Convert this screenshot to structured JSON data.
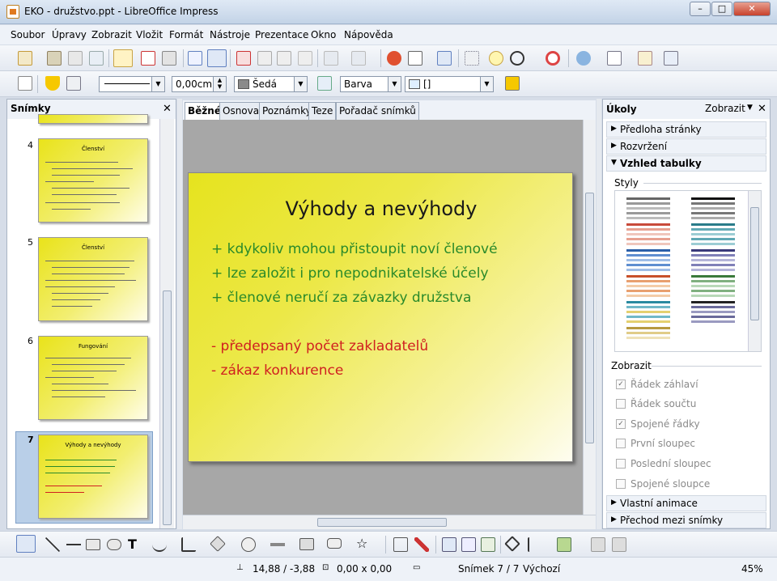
{
  "window": {
    "title": "EKO - družstvo.ppt - LibreOffice Impress"
  },
  "menu": [
    "Soubor",
    "Úpravy",
    "Zobrazit",
    "Vložit",
    "Formát",
    "Nástroje",
    "Prezentace",
    "Okno",
    "Nápověda"
  ],
  "line_props": {
    "line_width": "0,00cm",
    "line_color": "Šedá",
    "area_style": "Barva",
    "area_value": "[]"
  },
  "slides_panel": {
    "title": "Snímky",
    "thumbs": [
      {
        "num": "4",
        "title": "Členství"
      },
      {
        "num": "5",
        "title": "Členství"
      },
      {
        "num": "6",
        "title": "Fungování"
      },
      {
        "num": "7",
        "title": "Výhody a nevýhody"
      }
    ]
  },
  "tabs": [
    "Běžné",
    "Osnova",
    "Poznámky",
    "Teze",
    "Pořadač snímků"
  ],
  "slide": {
    "title": "Výhody a nevýhody",
    "pros": [
      "+ kdykoliv mohou přistoupit noví členové",
      "+ lze založit i pro nepodnikatelské účely",
      "+ členové neručí za závazky družstva"
    ],
    "cons": [
      "- předepsaný počet zakladatelů",
      "- zákaz konkurence"
    ],
    "pro_color": "#2a8a2a",
    "con_color": "#d02020"
  },
  "tasks_panel": {
    "title": "Úkoly",
    "view_label": "Zobrazit",
    "sections": [
      "Předloha stránky",
      "Rozvržení",
      "Vzhled tabulky"
    ],
    "styles_label": "Styly",
    "show_label": "Zobrazit",
    "options": [
      {
        "label": "Řádek záhlaví",
        "checked": true
      },
      {
        "label": "Řádek součtu",
        "checked": false
      },
      {
        "label": "Spojené řádky",
        "checked": true
      },
      {
        "label": "První sloupec",
        "checked": false
      },
      {
        "label": "Poslední sloupec",
        "checked": false
      },
      {
        "label": "Spojené sloupce",
        "checked": false
      }
    ],
    "bottom_sections": [
      "Vlastní animace",
      "Přechod mezi snímky"
    ]
  },
  "status": {
    "position": "14,88 / -3,88",
    "size": "0,00 x 0,00",
    "slide": "Snímek 7 / 7",
    "layout": "Výchozí",
    "zoom": "45%"
  }
}
